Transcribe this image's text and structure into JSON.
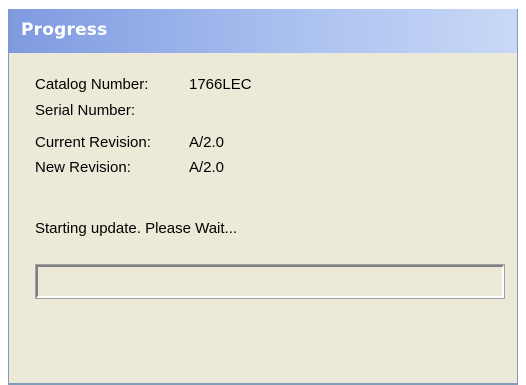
{
  "window": {
    "title": "Progress"
  },
  "info": {
    "catalog_label": "Catalog Number:",
    "catalog_value": "1766LEC",
    "serial_label": "Serial Number:",
    "serial_value": "",
    "current_label": "Current Revision:",
    "current_value": "A/2.0",
    "new_label": "New Revision:",
    "new_value": "A/2.0"
  },
  "status": {
    "message": "Starting update. Please Wait..."
  },
  "progress": {
    "fraction": 0
  },
  "colors": {
    "title_bar_start": "#7f9ae0",
    "title_bar_end": "#c9d8f6",
    "window_background": "#ece9d8",
    "progress_fill": "#3d7ad6"
  }
}
